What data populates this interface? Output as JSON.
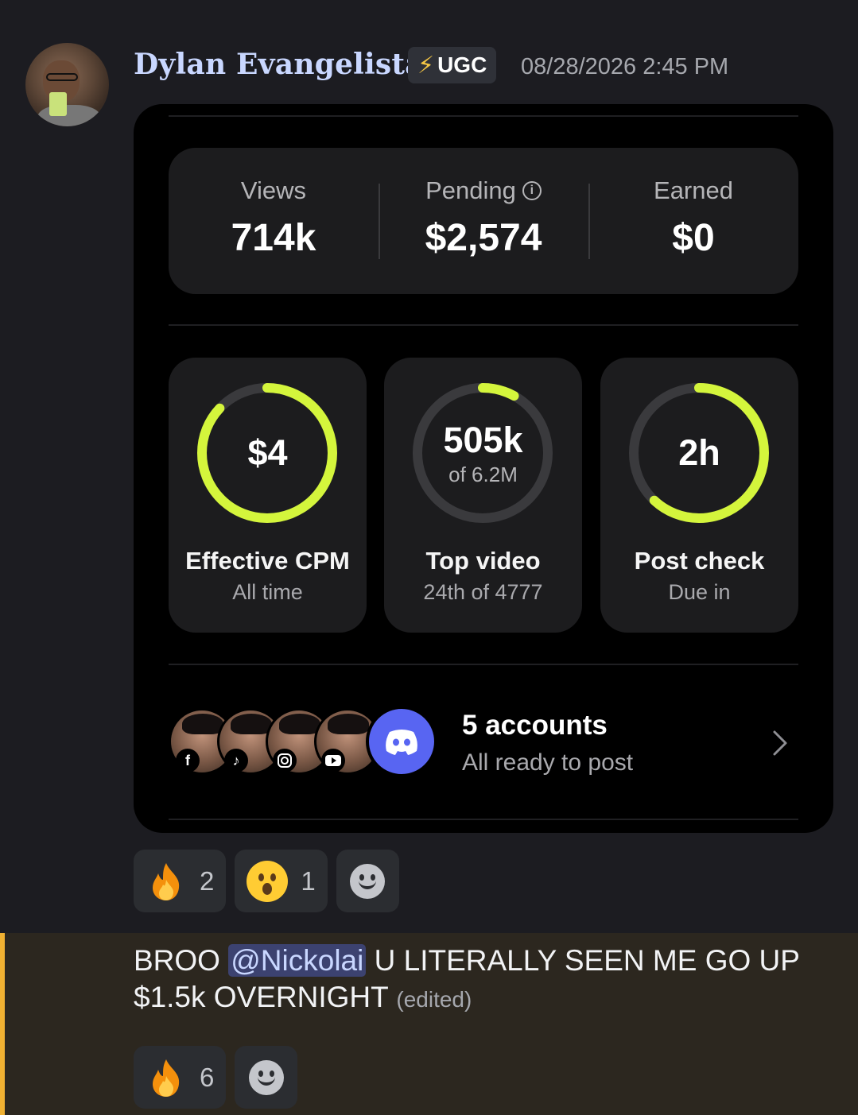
{
  "message": {
    "author": "Dylan Evangelista",
    "role_tag": "UGC",
    "timestamp": "08/28/2026 2:45 PM"
  },
  "card": {
    "stats": [
      {
        "label": "Views",
        "value": "714k"
      },
      {
        "label": "Pending",
        "value": "$2,574",
        "info_icon": "info-icon"
      },
      {
        "label": "Earned",
        "value": "$0"
      }
    ],
    "tiles": [
      {
        "main": "$4",
        "sub": "",
        "title": "Effective CPM",
        "subtitle": "All time",
        "progress": 0.87
      },
      {
        "main": "505k",
        "sub": "of 6.2M",
        "title": "Top video",
        "subtitle": "24th of 4777",
        "progress": 0.08
      },
      {
        "main": "2h",
        "sub": "",
        "title": "Post check",
        "subtitle": "Due in",
        "progress": 0.62
      }
    ],
    "accounts": {
      "title": "5 accounts",
      "subtitle": "All ready to post",
      "platforms": [
        "facebook-icon",
        "tiktok-icon",
        "instagram-icon",
        "youtube-icon",
        "discord-icon"
      ]
    },
    "accent_color": "#d4f53c"
  },
  "reactions_1": [
    {
      "emoji": "fire",
      "count": "2"
    },
    {
      "emoji": "astonished",
      "count": "1"
    }
  ],
  "reply": {
    "prefix": "BROO",
    "mention": "@Nickolai",
    "text_line1": "U LITERALLY SEEN ME GO UP",
    "text_line2": "$1.5k OVERNIGHT",
    "edited": "(edited)"
  },
  "reactions_2": [
    {
      "emoji": "fire",
      "count": "6"
    }
  ]
}
